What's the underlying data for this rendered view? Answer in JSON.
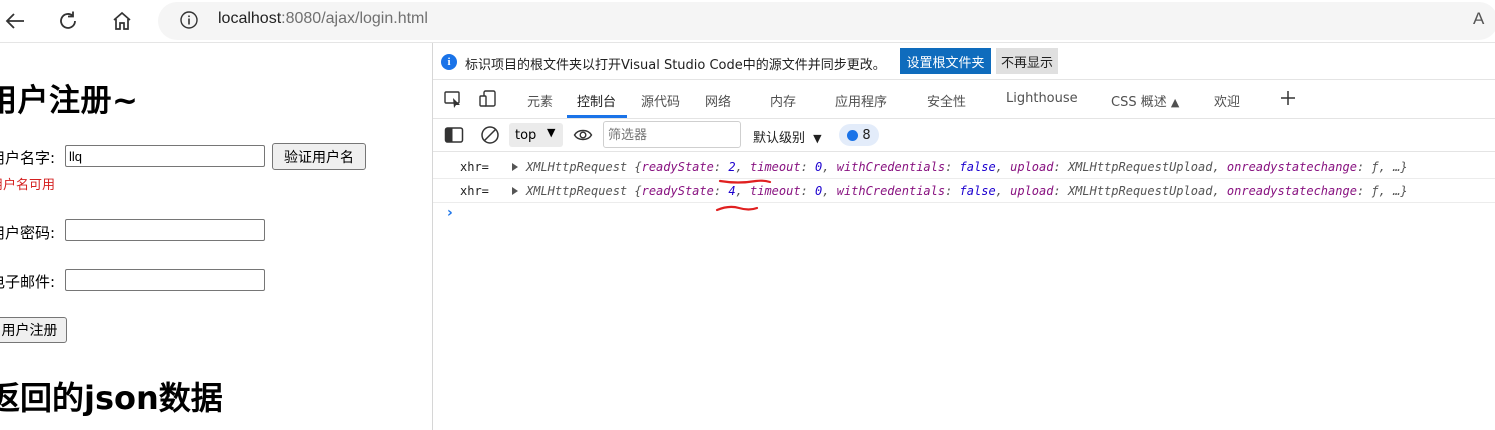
{
  "browser": {
    "url_host": "localhost",
    "url_rest": ":8080/ajax/login.html",
    "read_aloud": "A"
  },
  "page": {
    "heading": "用户注册~",
    "username_label": "用户名字:",
    "username_value": "llq",
    "verify_button": "验证用户名",
    "username_ok": "用户名可用",
    "password_label": "用户密码:",
    "email_label": "电子邮件:",
    "register_button": "用户注册",
    "json_heading": "返回的json数据"
  },
  "devtools": {
    "infobar_text": "标识项目的根文件夹以打开Visual Studio Code中的源文件并同步更改。",
    "set_root_button": "设置根文件夹",
    "dont_show_button": "不再显示",
    "tabs": [
      "元素",
      "控制台",
      "源代码",
      "网络",
      "内存",
      "应用程序",
      "安全性",
      "Lighthouse",
      "CSS 概述",
      "欢迎"
    ],
    "active_tab": "控制台",
    "context_select": "top",
    "filter_placeholder": "筛选器",
    "levels_label": "默认级别",
    "message_count": "8",
    "console": [
      {
        "label": "xhr=",
        "type": "XMLHttpRequest",
        "readyState": "2",
        "timeout": "0",
        "withCredentials": "false",
        "upload": "XMLHttpRequestUpload",
        "onreadystatechange": "ƒ",
        "more": "…"
      },
      {
        "label": "xhr=",
        "type": "XMLHttpRequest",
        "readyState": "4",
        "timeout": "0",
        "withCredentials": "false",
        "upload": "XMLHttpRequestUpload",
        "onreadystatechange": "ƒ",
        "more": "…"
      }
    ],
    "prompt": "›"
  },
  "colors": {
    "accent_blue": "#1a73e8",
    "set_root_bg": "#0f6cbd",
    "ok_red": "#d42020",
    "annotation_red": "#e02020"
  }
}
